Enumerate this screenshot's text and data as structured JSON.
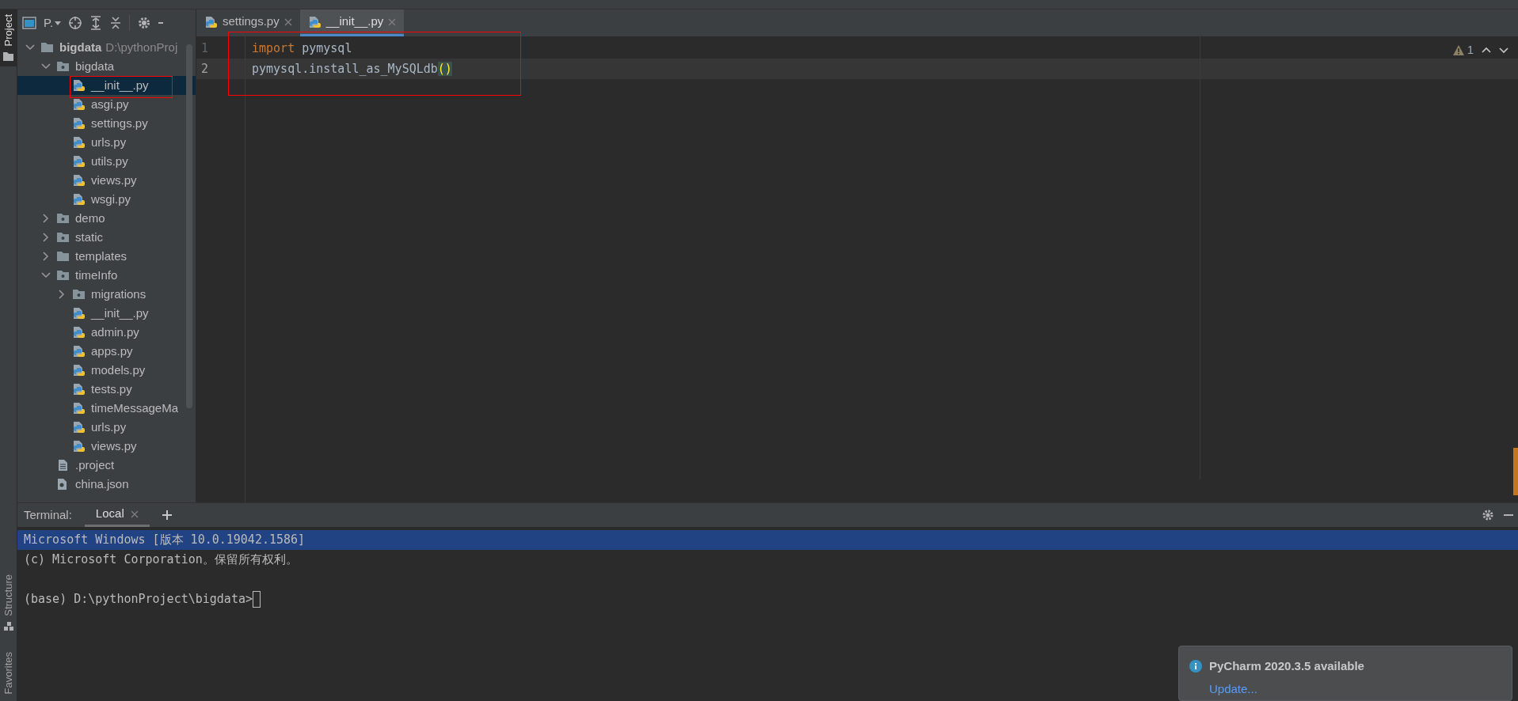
{
  "side_tabs": [
    {
      "label": "Project",
      "selected": true,
      "kind": "project"
    },
    {
      "label": "Structure",
      "selected": false,
      "kind": "structure"
    },
    {
      "label": "Favorites",
      "selected": false,
      "kind": "favorites"
    }
  ],
  "project_panel": {
    "title": "P.",
    "tree": [
      {
        "label": "bigdata",
        "path": "D:\\pythonProj",
        "kind": "folder",
        "expanded": true,
        "selected": false,
        "children": [
          {
            "label": "bigdata",
            "kind": "package",
            "expanded": true,
            "selected": false,
            "children": [
              {
                "label": "__init__.py",
                "kind": "python",
                "selected": true
              },
              {
                "label": "asgi.py",
                "kind": "python",
                "selected": false
              },
              {
                "label": "settings.py",
                "kind": "python",
                "selected": false
              },
              {
                "label": "urls.py",
                "kind": "python",
                "selected": false
              },
              {
                "label": "utils.py",
                "kind": "python",
                "selected": false
              },
              {
                "label": "views.py",
                "kind": "python",
                "selected": false
              },
              {
                "label": "wsgi.py",
                "kind": "python",
                "selected": false
              }
            ]
          },
          {
            "label": "demo",
            "kind": "package",
            "expanded": false,
            "selected": false
          },
          {
            "label": "static",
            "kind": "package",
            "expanded": false,
            "selected": false
          },
          {
            "label": "templates",
            "kind": "folder",
            "expanded": false,
            "selected": false
          },
          {
            "label": "timeInfo",
            "kind": "package",
            "expanded": true,
            "selected": false,
            "children": [
              {
                "label": "migrations",
                "kind": "package",
                "expanded": false,
                "selected": false
              },
              {
                "label": "__init__.py",
                "kind": "python",
                "selected": false
              },
              {
                "label": "admin.py",
                "kind": "python",
                "selected": false
              },
              {
                "label": "apps.py",
                "kind": "python",
                "selected": false
              },
              {
                "label": "models.py",
                "kind": "python",
                "selected": false
              },
              {
                "label": "tests.py",
                "kind": "python",
                "selected": false
              },
              {
                "label": "timeMessageMa",
                "kind": "python",
                "selected": false
              },
              {
                "label": "urls.py",
                "kind": "python",
                "selected": false
              },
              {
                "label": "views.py",
                "kind": "python",
                "selected": false
              }
            ]
          },
          {
            "label": ".project",
            "kind": "text",
            "selected": false
          },
          {
            "label": "china.json",
            "kind": "json",
            "selected": false
          }
        ]
      }
    ]
  },
  "editor_tabs": [
    {
      "label": "settings.py",
      "selected": false
    },
    {
      "label": "__init__.py",
      "selected": true
    }
  ],
  "code_lines": [
    {
      "number": "1",
      "current": false,
      "tokens": [
        {
          "kind": "keyword",
          "text": "import"
        },
        {
          "kind": "plain",
          "text": " pymysql"
        }
      ]
    },
    {
      "number": "2",
      "current": true,
      "tokens": [
        {
          "kind": "plain",
          "text": "pymysql.install_as_MySQLdb"
        },
        {
          "kind": "brace",
          "text": "()"
        }
      ]
    }
  ],
  "inspection": {
    "warnings": "1"
  },
  "terminal": {
    "title": "Terminal:",
    "tabs": [
      {
        "label": "Local",
        "selected": true
      }
    ],
    "lines": [
      {
        "text": "Microsoft Windows [版本 10.0.19042.1586]",
        "selected": true
      },
      {
        "text": "(c) Microsoft Corporation。保留所有权利。",
        "selected": false
      }
    ],
    "prompt": "(base) D:\\pythonProject\\bigdata>"
  },
  "notification": {
    "title": "PyCharm 2020.3.5 available",
    "link": "Update..."
  }
}
